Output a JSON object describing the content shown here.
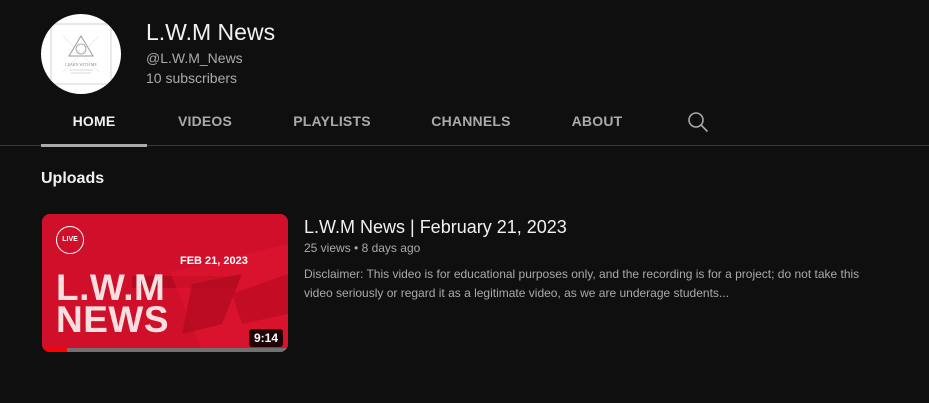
{
  "channel": {
    "name": "L.W.M News",
    "handle": "@L.W.M_News",
    "subscribers": "10 subscribers",
    "avatar_text": "LEARN WITH ME"
  },
  "tabs": [
    {
      "label": "HOME",
      "active": true
    },
    {
      "label": "VIDEOS",
      "active": false
    },
    {
      "label": "PLAYLISTS",
      "active": false
    },
    {
      "label": "CHANNELS",
      "active": false
    },
    {
      "label": "ABOUT",
      "active": false
    }
  ],
  "search": {
    "icon": "search-icon"
  },
  "uploads": {
    "title": "Uploads",
    "videos": [
      {
        "title": "L.W.M News | February 21, 2023",
        "views": "25 views",
        "separator": "•",
        "age": "8 days ago",
        "description": "Disclaimer: This video is for educational purposes only, and the recording is for a project; do not take this video seriously or regard it as a legitimate video, as we are underage students...",
        "duration": "9:14",
        "watched_fraction": 0.1,
        "thumbnail": {
          "badge": "LIVE",
          "date": "FEB 21, 2023",
          "title": "L.W.M\nNEWS"
        }
      }
    ]
  },
  "colors": {
    "background": "#0f0f0f",
    "thumbnail_red": "#d0102a",
    "progress_red": "#ff0000",
    "text_primary": "#f1f1f1",
    "text_secondary": "#aaaaaa"
  }
}
